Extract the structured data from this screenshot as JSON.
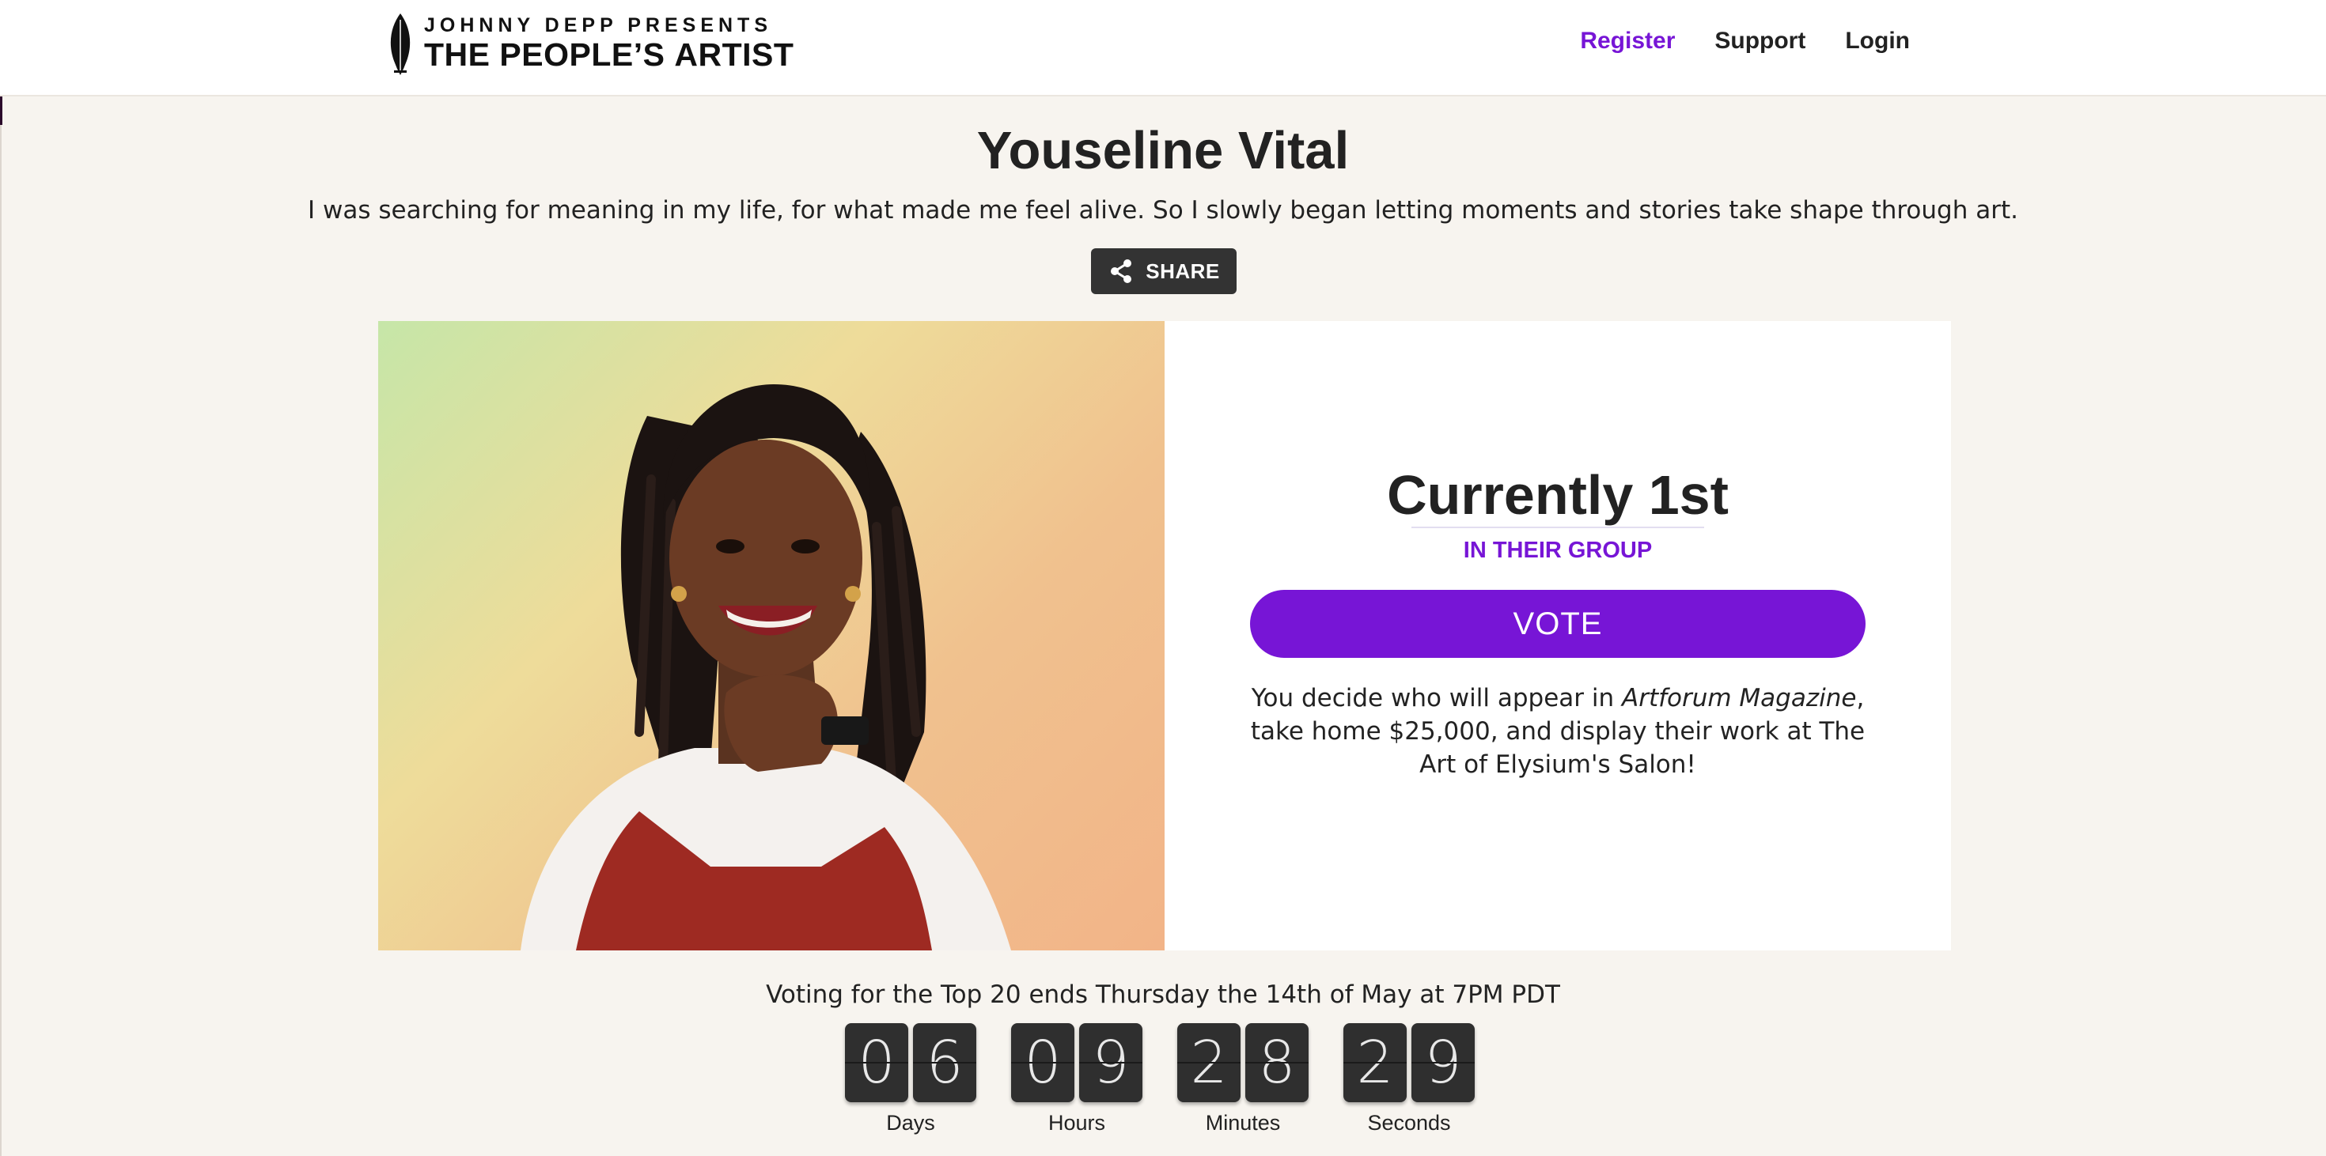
{
  "header": {
    "logo_top": "JOHNNY DEPP PRESENTS",
    "logo_bottom_prefix": "THE PEOPLE’S",
    "logo_bottom_emph": "ARTIST",
    "nav": [
      {
        "label": "Register",
        "active": true
      },
      {
        "label": "Support",
        "active": false
      },
      {
        "label": "Login",
        "active": false
      }
    ]
  },
  "profile": {
    "name": "Youseline Vital",
    "bio": "I was searching for meaning in my life, for what made me feel alive. So I slowly began letting moments and stories take shape through art.",
    "share_label": "SHARE"
  },
  "standing": {
    "rank": "Currently 1st",
    "group_label": "IN THEIR GROUP",
    "vote_label": "VOTE",
    "blurb_prefix": "You decide who will appear in ",
    "blurb_italic": "Artforum Magazine",
    "blurb_suffix": ", take home $25,000, and display their work at The Art of Elysium's Salon!"
  },
  "countdown": {
    "deadline_text": "Voting for the Top 20 ends Thursday the 14th of May at 7PM PDT",
    "units": [
      {
        "digits": [
          "0",
          "6"
        ],
        "label": "Days"
      },
      {
        "digits": [
          "0",
          "9"
        ],
        "label": "Hours"
      },
      {
        "digits": [
          "2",
          "8"
        ],
        "label": "Minutes"
      },
      {
        "digits": [
          "2",
          "9"
        ],
        "label": "Seconds"
      }
    ]
  },
  "colors": {
    "accent": "#7715d6",
    "page_bg": "#f7f4ef",
    "dark_button": "#333333"
  },
  "icons": {
    "logo": "quill-icon",
    "share": "share-icon"
  }
}
